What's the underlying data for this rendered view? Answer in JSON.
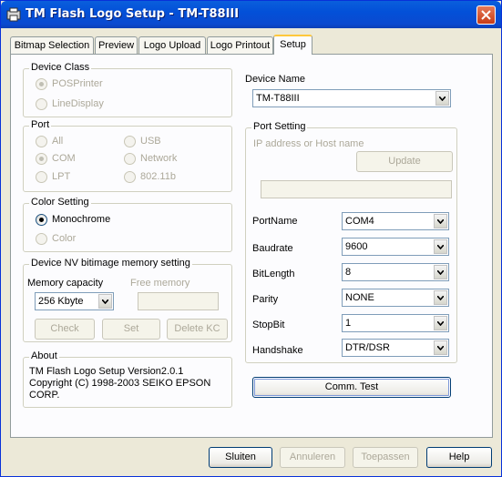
{
  "window": {
    "title": "TM Flash Logo Setup - TM-T88III",
    "title_bar_color": "#0a4ad0",
    "icon": "app-icon"
  },
  "tabs": [
    {
      "label": "Bitmap Selection"
    },
    {
      "label": "Preview"
    },
    {
      "label": "Logo Upload"
    },
    {
      "label": "Logo Printout"
    },
    {
      "label": "Setup",
      "active": true
    }
  ],
  "device_class": {
    "legend": "Device Class",
    "options": [
      {
        "label": "POSPrinter",
        "selected": true
      },
      {
        "label": "LineDisplay",
        "selected": false
      }
    ]
  },
  "port": {
    "legend": "Port",
    "options": [
      {
        "label": "All",
        "selected": false
      },
      {
        "label": "USB",
        "selected": false
      },
      {
        "label": "COM",
        "selected": true
      },
      {
        "label": "Network",
        "selected": false
      },
      {
        "label": "LPT",
        "selected": false
      },
      {
        "label": "802.11b",
        "selected": false
      }
    ]
  },
  "color_setting": {
    "legend": "Color Setting",
    "options": [
      {
        "label": "Monochrome",
        "selected": true
      },
      {
        "label": "Color",
        "selected": false
      }
    ]
  },
  "nv_memory": {
    "legend": "Device NV bitimage memory setting",
    "memory_capacity_label": "Memory capacity",
    "memory_capacity_value": "256 Kbyte",
    "free_memory_label": "Free memory",
    "free_memory_value": "",
    "check_button": "Check",
    "set_button": "Set",
    "delete_button": "Delete KC"
  },
  "about": {
    "legend": "About",
    "line1": "TM Flash Logo Setup Version2.0.1",
    "line2": "Copyright (C) 1998-2003 SEIKO EPSON",
    "line3": "CORP."
  },
  "device_name": {
    "label": "Device Name",
    "value": "TM-T88III"
  },
  "port_setting": {
    "legend": "Port Setting",
    "ip_label": "IP address or Host name",
    "update_button": "Update",
    "ip_value": "",
    "rows": [
      {
        "label": "PortName",
        "value": "COM4"
      },
      {
        "label": "Baudrate",
        "value": "9600"
      },
      {
        "label": "BitLength",
        "value": "8"
      },
      {
        "label": "Parity",
        "value": "NONE"
      },
      {
        "label": "StopBit",
        "value": "1"
      },
      {
        "label": "Handshake",
        "value": "DTR/DSR"
      }
    ]
  },
  "comm_test_button": "Comm. Test",
  "footer": {
    "close_button": "Sluiten",
    "cancel_button": "Annuleren",
    "apply_button": "Toepassen",
    "help_button": "Help"
  }
}
